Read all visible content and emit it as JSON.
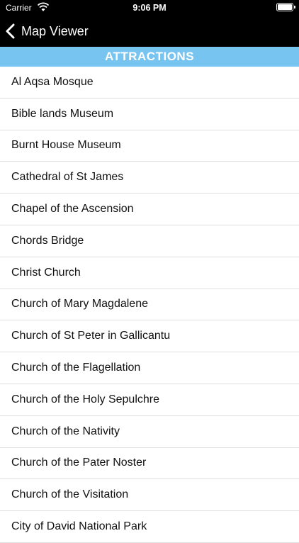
{
  "status_bar": {
    "carrier": "Carrier",
    "time": "9:06 PM"
  },
  "nav": {
    "back_label": "Map Viewer"
  },
  "section": {
    "title": "ATTRACTIONS"
  },
  "attractions": [
    "Al Aqsa Mosque",
    "Bible lands Museum",
    "Burnt House Museum",
    "Cathedral of St James",
    "Chapel of the Ascension",
    "Chords Bridge",
    "Christ Church",
    "Church of Mary Magdalene",
    "Church of St Peter in Gallicantu",
    "Church of the Flagellation",
    "Church of the Holy Sepulchre",
    "Church of the Nativity",
    "Church of the Pater Noster",
    "Church of the Visitation",
    "City of David National Park"
  ],
  "colors": {
    "header_bg": "#77c4f0",
    "bar_bg": "#000000"
  }
}
